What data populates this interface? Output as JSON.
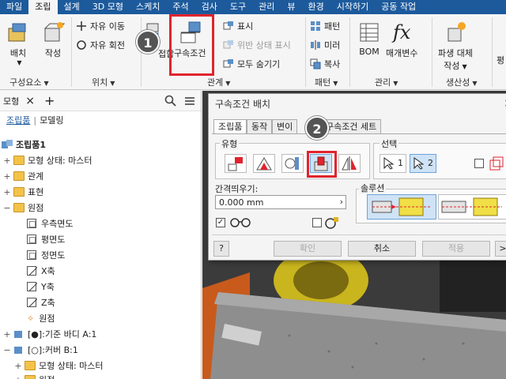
{
  "tabs": [
    "파일",
    "조립",
    "설계",
    "3D 모형",
    "스케치",
    "주석",
    "검사",
    "도구",
    "관리",
    "뷰",
    "환경",
    "시작하기",
    "공동 작업"
  ],
  "active_tab_index": 1,
  "ribbon": {
    "place": "배치",
    "create": "작성",
    "group_component": "구성요소",
    "free_move": "자유 이동",
    "free_rotate": "자유 회전",
    "group_position": "위치",
    "join": "접합",
    "constrain": "구속조건",
    "show": "표시",
    "show_sick": "위반 상태 표시",
    "hide_all": "모두 숨기기",
    "group_relationships": "관계",
    "pattern": "패턴",
    "mirror": "미러",
    "copy": "복사",
    "group_pattern": "패턴",
    "bom": "BOM",
    "params": "매개변수",
    "fx": "fx",
    "group_manage": "관리",
    "derived_replace": "파생 대체",
    "derived_replace_2": "작성",
    "group_productivity": "생산성",
    "partial": "평"
  },
  "callouts": [
    "1",
    "2"
  ],
  "browser": {
    "tab": "모형",
    "close": "×",
    "add": "+",
    "sub_assembly": "조립품",
    "sub_sep": "|",
    "sub_modeling": "모델링",
    "rows": [
      {
        "label": "조립품1",
        "level": 0
      },
      {
        "label": "모형 상태: 마스터",
        "level": 1
      },
      {
        "label": "관계",
        "level": 1
      },
      {
        "label": "표현",
        "level": 1
      },
      {
        "label": "원점",
        "level": 1
      },
      {
        "label": "우측면도",
        "level": 2
      },
      {
        "label": "평면도",
        "level": 2
      },
      {
        "label": "정면도",
        "level": 2
      },
      {
        "label": "X축",
        "level": 2
      },
      {
        "label": "Y축",
        "level": 2
      },
      {
        "label": "Z축",
        "level": 2
      },
      {
        "label": "원점",
        "level": 2
      },
      {
        "label": "[●]:기준 바디 A:1",
        "level": 1
      },
      {
        "label": "[○]:커버 B:1",
        "level": 1
      },
      {
        "label": "모형 상태: 마스터",
        "level": 2
      },
      {
        "label": "원점",
        "level": 2
      }
    ]
  },
  "dialog": {
    "title": "구속조건 배치",
    "close": "×",
    "tabs": [
      "조립품",
      "동작",
      "변이",
      "구속조건 세트"
    ],
    "group_type": "유형",
    "group_selection": "선택",
    "sel1": "1",
    "sel2": "2",
    "offset_label": "간격띄우기:",
    "offset_value": "0.000 mm",
    "group_solution": "솔루션",
    "help": "?",
    "ok": "확인",
    "cancel": "취소",
    "apply": "적용",
    "more": ">"
  },
  "colors": {
    "ribbon_blue": "#1c5a9c",
    "highlight_red": "#e0242d",
    "selected_blue": "#cfe3f7"
  }
}
